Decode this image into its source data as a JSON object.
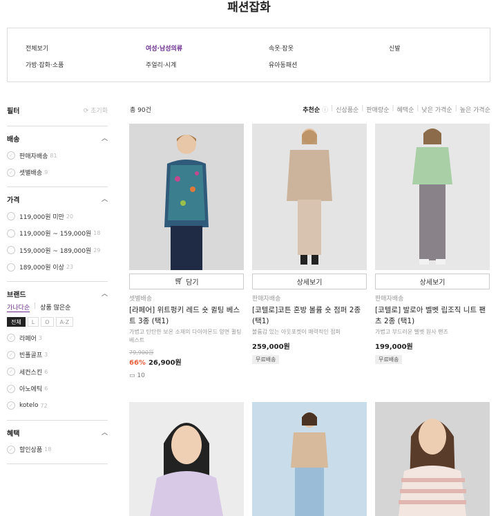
{
  "page_title": "패션잡화",
  "categories": [
    {
      "label": "전체보기"
    },
    {
      "label": "여성·남성의류"
    },
    {
      "label": "속옷·잠옷"
    },
    {
      "label": "신발"
    },
    {
      "label": "가방·잡화·소품"
    },
    {
      "label": "주얼리·시계"
    },
    {
      "label": "유아동패션"
    }
  ],
  "filter": {
    "title": "필터",
    "reset": "초기화",
    "shipping": {
      "title": "배송",
      "options": [
        {
          "label": "판매자배송",
          "count": "81"
        },
        {
          "label": "셋별배송",
          "count": "9"
        }
      ]
    },
    "price": {
      "title": "가격",
      "options": [
        {
          "label": "119,000원 미만",
          "count": "20"
        },
        {
          "label": "119,000원 ~ 159,000원",
          "count": "18"
        },
        {
          "label": "159,000원 ~ 189,000원",
          "count": "29"
        },
        {
          "label": "189,000원 이상",
          "count": "23"
        }
      ]
    },
    "brand": {
      "title": "브랜드",
      "sort_tabs": [
        "가나다순",
        "상품 많은순"
      ],
      "segments": [
        "전체",
        "L",
        "O",
        "A-Z"
      ],
      "options": [
        {
          "label": "라페어",
          "count": "3"
        },
        {
          "label": "빈폴골프",
          "count": "3"
        },
        {
          "label": "세컨스킨",
          "count": "6"
        },
        {
          "label": "아노에틱",
          "count": "6"
        },
        {
          "label": "kotelo",
          "count": "72"
        }
      ]
    },
    "benefit": {
      "title": "혜택",
      "options": [
        {
          "label": "할인상품",
          "count": "18"
        }
      ]
    }
  },
  "list": {
    "total": "총 90건",
    "sort": [
      "추천순",
      "신상품순",
      "판매량순",
      "혜택순",
      "낮은 가격순",
      "높은 가격순"
    ],
    "products": [
      {
        "button": "담기",
        "shipping": "셋별배송",
        "name": "[라페어] 위트펑키 레드 숏 퀼팅 베스트 3종 (택1)",
        "desc": "가볍고 탄탄한 보온 소재의 다이아몬드 양면 퀼팅 베스트",
        "original": "79,900원",
        "discount": "66%",
        "price": "26,900원",
        "reviews": "10"
      },
      {
        "button": "상세보기",
        "shipping": "판매자배송",
        "name": "[코텔로]코튼 혼방 볼륨 숏 점퍼 2종 (택1)",
        "desc": "볼륨감 있는 아웃포켓이 매력적인 점퍼",
        "price": "259,000원",
        "badge": "무료배송"
      },
      {
        "button": "상세보기",
        "shipping": "판매자배송",
        "name": "[코텔로] 발로아 벨벳 립조직 니트 팬츠 2종 (택1)",
        "desc": "가볍고 부드러운 벨벳 원사 팬츠",
        "price": "199,000원",
        "badge": "무료배송"
      }
    ]
  },
  "colors": {
    "accent": "#6b2c8e",
    "discount": "#e8613e"
  }
}
